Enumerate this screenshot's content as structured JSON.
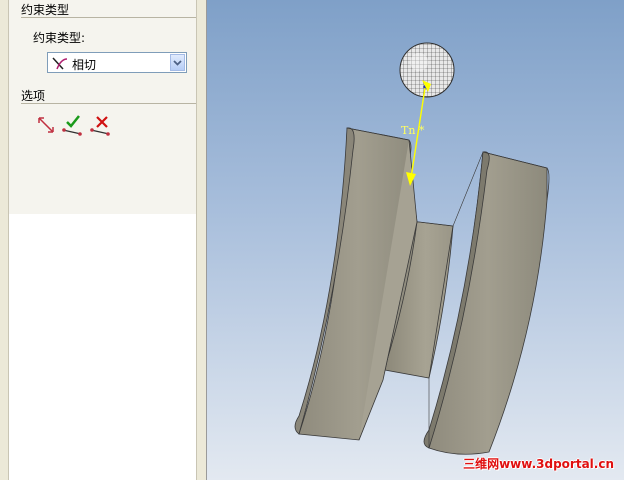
{
  "panel": {
    "constraint_type_heading": "约束类型",
    "constraint_type_label": "约束类型:",
    "constraint_type_value": "相切",
    "options_heading": "选项"
  },
  "viewport": {
    "tangent_label": "Tn *",
    "watermark": "三维网www.3dportal.cn"
  },
  "icons": {
    "constraint_type": "tangent-icon",
    "options": [
      "flip-direction-icon",
      "accept-icon",
      "cancel-icon"
    ]
  },
  "colors": {
    "constraint_arrow": "#ffff00",
    "watermark": "#e01010",
    "accept": "#1a9a1a",
    "cancel": "#d01010"
  }
}
